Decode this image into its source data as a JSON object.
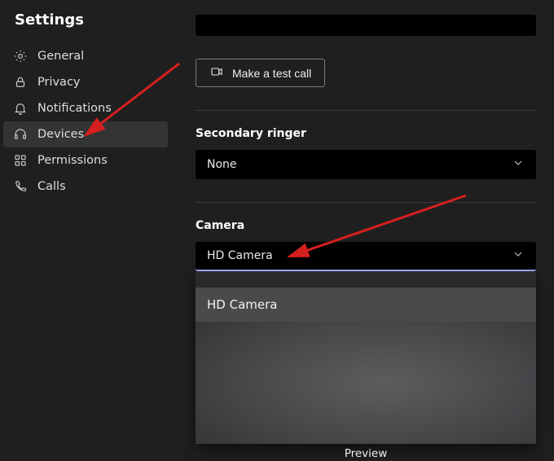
{
  "title": "Settings",
  "sidebar": {
    "items": [
      {
        "label": "General"
      },
      {
        "label": "Privacy"
      },
      {
        "label": "Notifications"
      },
      {
        "label": "Devices"
      },
      {
        "label": "Permissions"
      },
      {
        "label": "Calls"
      }
    ]
  },
  "main": {
    "test_call_label": "Make a test call",
    "secondary_ringer": {
      "label": "Secondary ringer",
      "value": "None"
    },
    "camera": {
      "label": "Camera",
      "value": "HD Camera",
      "options": [
        "HD Camera"
      ],
      "preview_label": "Preview"
    }
  },
  "colors": {
    "accent": "#9ea2ff",
    "annotation": "#d61f1f"
  }
}
